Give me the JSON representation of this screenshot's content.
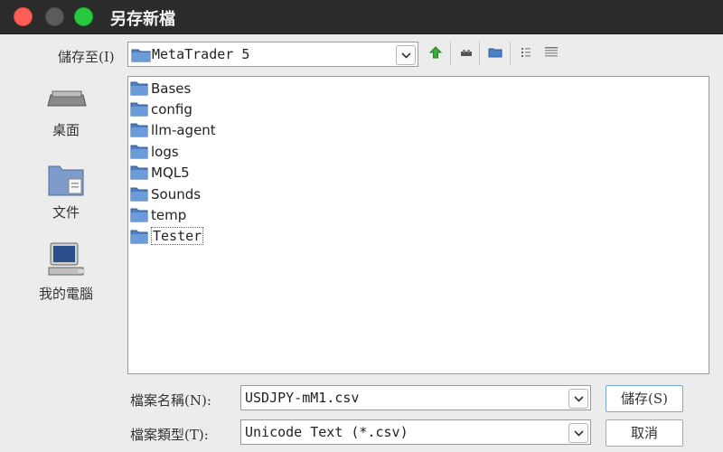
{
  "window": {
    "title": "另存新檔"
  },
  "save_in": {
    "label": "儲存至(I)",
    "value": "MetaTrader 5"
  },
  "toolbar": {
    "icons": [
      "up-folder-icon",
      "network-icon",
      "new-folder-icon",
      "list-view-icon",
      "details-view-icon"
    ]
  },
  "places": [
    {
      "label": "桌面",
      "icon": "desktop-icon"
    },
    {
      "label": "文件",
      "icon": "documents-icon"
    },
    {
      "label": "我的電腦",
      "icon": "computer-icon"
    }
  ],
  "files": [
    {
      "name": "Bases"
    },
    {
      "name": "config"
    },
    {
      "name": "llm-agent"
    },
    {
      "name": "logs"
    },
    {
      "name": "MQL5"
    },
    {
      "name": "Sounds"
    },
    {
      "name": "temp"
    },
    {
      "name": "Tester",
      "selected": true
    }
  ],
  "filename": {
    "label": "檔案名稱(N):",
    "value": "USDJPY-mM1.csv"
  },
  "filetype": {
    "label": "檔案類型(T):",
    "value": "Unicode Text (*.csv)"
  },
  "buttons": {
    "save": "儲存(S)",
    "cancel": "取消"
  }
}
